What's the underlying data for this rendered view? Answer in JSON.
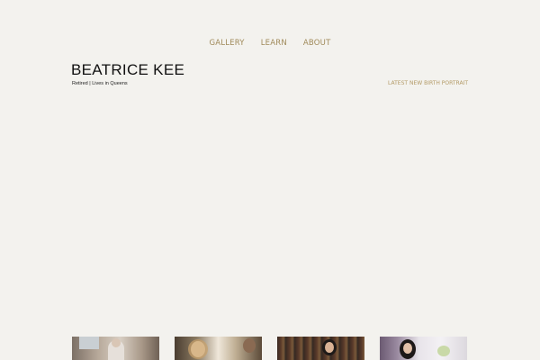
{
  "nav": {
    "items": [
      {
        "label": "GALLERY"
      },
      {
        "label": "LEARN"
      },
      {
        "label": "ABOUT"
      }
    ]
  },
  "header": {
    "name": "BEATRICE KEE",
    "subtitle": "Retired | Lives in Queens"
  },
  "latest_link": "LATEST NEW BIRTH PORTRAIT",
  "colors": {
    "background": "#f3f2ee",
    "nav_link": "#a08a5a",
    "accent_link": "#b39a66",
    "title": "#111111"
  }
}
